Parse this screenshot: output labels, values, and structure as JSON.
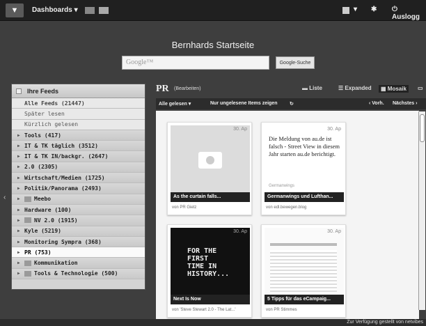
{
  "topbar": {
    "dashboards_label": "Dashboards ▾",
    "logout_label": "Auslogg",
    "menu_label": "▾"
  },
  "header": {
    "title": "Bernhards Startseite",
    "search_placeholder": "Google™",
    "search_button": "Google-Suche"
  },
  "sidebar": {
    "title": "Ihre Feeds",
    "items": [
      {
        "label": "Alle Feeds (21447)",
        "type": "sub first"
      },
      {
        "label": "Später lesen",
        "type": "sub"
      },
      {
        "label": "Kürzlich gelesen",
        "type": "sub"
      },
      {
        "label": "Tools (417)",
        "type": "folder"
      },
      {
        "label": "IT & TK täglich (3512)",
        "type": "folder"
      },
      {
        "label": "IT & TK IN/backgr. (2647)",
        "type": "folder"
      },
      {
        "label": "2.0 (2305)",
        "type": "folder"
      },
      {
        "label": "Wirtschaft/Medien (1725)",
        "type": "folder"
      },
      {
        "label": "Politik/Panorama (2493)",
        "type": "folder"
      },
      {
        "label": "Meebo",
        "type": "folder-icon"
      },
      {
        "label": "Hardware (100)",
        "type": "folder"
      },
      {
        "label": "NV 2.0 (1915)",
        "type": "folder-icon"
      },
      {
        "label": "Kyle (5219)",
        "type": "folder"
      },
      {
        "label": "Monitoring Sympra (368)",
        "type": "folder"
      },
      {
        "label": "PR (753)",
        "type": "selected"
      },
      {
        "label": "Kommunikation",
        "type": "folder-icon"
      },
      {
        "label": "Tools & Technologie (500)",
        "type": "folder-icon"
      }
    ]
  },
  "main": {
    "title": "PR",
    "edit_label": "(Bearbeiten)",
    "views": {
      "list": "Liste",
      "expanded": "Expanded",
      "mosaic": "Mosaik"
    },
    "toolbar": {
      "mark_read": "Alle gelesen ▾",
      "unread_only": "Nur ungelesene Items zeigen",
      "prev": "‹ Vorh.",
      "next": "Nächstes ›"
    },
    "cards": [
      {
        "date": "30. Ap",
        "title": "As the curtain falls...",
        "source": "von PR Gietz"
      },
      {
        "date": "30. Ap",
        "title": "Germanwings und Lufthan...",
        "source": "von edl.bewegen.blog",
        "text": "Die Meldung von au.de ist falsch - Street View in diesem Jahr starten au.de berichtigt.",
        "small": "Germanwings"
      },
      {
        "date": "30. Ap",
        "title": "Next Is Now",
        "source": "von 'Steve Stewart 2.0 - The Lat...'",
        "poster": "FOR THE FIRST TIME IN HISTORY..."
      },
      {
        "date": "30. Ap",
        "title": "5 Tipps für das eCampaig...",
        "source": "von PR Stimmes"
      }
    ]
  },
  "footer": {
    "text": "Zur Verfügung gestellt von netvibes"
  }
}
